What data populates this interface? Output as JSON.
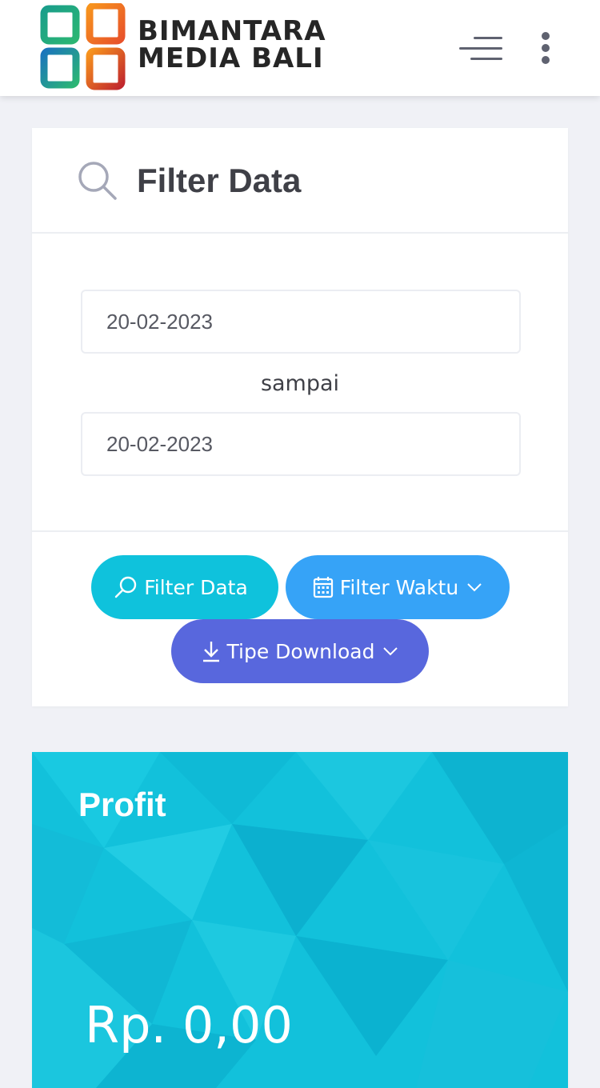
{
  "header": {
    "brand_line1": "BIMANTARA",
    "brand_line2": "MEDIA BALI",
    "menu_icon": "hamburger-menu-icon",
    "more_icon": "vertical-dots-icon"
  },
  "filter": {
    "title": "Filter Data",
    "icon": "search-icon",
    "date_from": "20-02-2023",
    "separator": "sampai",
    "date_to": "20-02-2023"
  },
  "actions": {
    "filter_data_label": "Filter Data",
    "filter_waktu_label": "Filter Waktu",
    "tipe_download_label": "Tipe Download"
  },
  "profit": {
    "title": "Profit",
    "value": "Rp. 0,00"
  },
  "colors": {
    "accent_cyan": "#0fc2dc",
    "accent_blue": "#36a3f7",
    "accent_indigo": "#5867dd",
    "profit_bg": "#12c1db"
  }
}
